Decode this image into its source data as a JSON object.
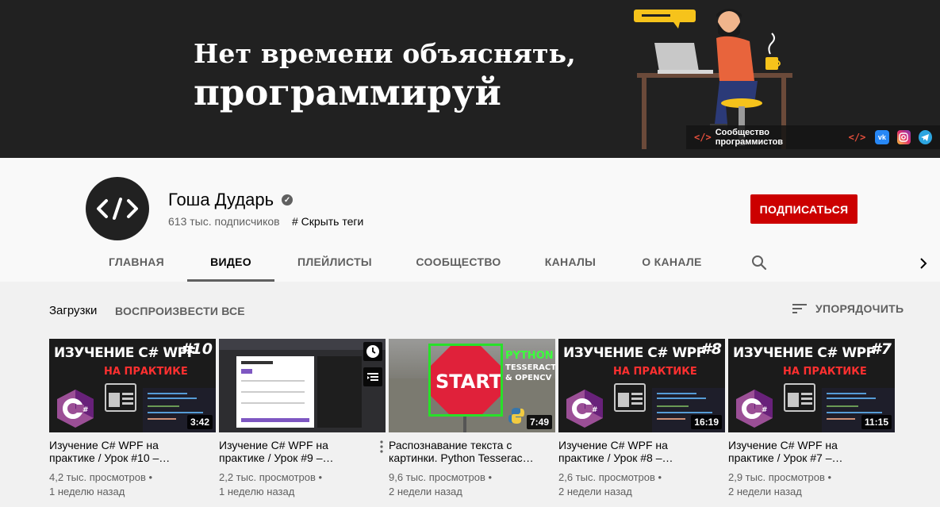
{
  "banner": {
    "line1": "Нет времени объяснять,",
    "line2": "программируй",
    "code_symbol": "</>",
    "community_label": "Сообщество программистов",
    "socials": [
      "vk-icon",
      "instagram-icon",
      "telegram-icon"
    ]
  },
  "channel": {
    "avatar_symbol": "</>",
    "name": "Гоша Дударь",
    "subscribers": "613 тыс. подписчиков",
    "tags_label": "# Скрыть теги",
    "subscribe_label": "ПОДПИСАТЬСЯ"
  },
  "tabs": [
    "ГЛАВНАЯ",
    "ВИДЕО",
    "ПЛЕЙЛИСТЫ",
    "СООБЩЕСТВО",
    "КАНАЛЫ",
    "О КАНАЛЕ"
  ],
  "active_tab": "ВИДЕО",
  "toolbar": {
    "uploads_label": "Загрузки",
    "play_all_label": "ВОСПРОИЗВЕСТИ ВСЕ",
    "sort_label": "УПОРЯДОЧИТЬ"
  },
  "videos": [
    {
      "title": "Изучение C# WPF на практике / Урок #10 –…",
      "duration": "3:42",
      "views": "4,2 тыс. просмотров •",
      "age": "1 неделю назад",
      "thumb_title": "ИЗУЧЕНИЕ C# WPF",
      "thumb_sub": "НА ПРАКТИКЕ",
      "thumb_num": "#10"
    },
    {
      "title": "Изучение C# WPF на практике / Урок #9 –…",
      "duration": "",
      "views": "2,2 тыс. просмотров •",
      "age": "1 неделю назад"
    },
    {
      "title": "Распознавание текста с картинки. Python Tesserac…",
      "duration": "7:49",
      "views": "9,6 тыс. просмотров •",
      "age": "2 недели назад",
      "thumb_start": "START",
      "thumb_python": "PYTHON",
      "thumb_tesseract": "TESSERACT",
      "thumb_opencv": "& OPENCV"
    },
    {
      "title": "Изучение C# WPF на практике / Урок #8 –…",
      "duration": "16:19",
      "views": "2,6 тыс. просмотров •",
      "age": "2 недели назад",
      "thumb_title": "ИЗУЧЕНИЕ C# WPF",
      "thumb_sub": "НА ПРАКТИКЕ",
      "thumb_num": "#8"
    },
    {
      "title": "Изучение C# WPF на практике / Урок #7 –…",
      "duration": "11:15",
      "views": "2,9 тыс. просмотров •",
      "age": "2 недели назад",
      "thumb_title": "ИЗУЧЕНИЕ C# WPF",
      "thumb_sub": "НА ПРАКТИКЕ",
      "thumb_num": "#7"
    }
  ],
  "colors": {
    "subscribe": "#cc0000",
    "banner_bg": "#212121",
    "accent_green": "#28e02a"
  }
}
